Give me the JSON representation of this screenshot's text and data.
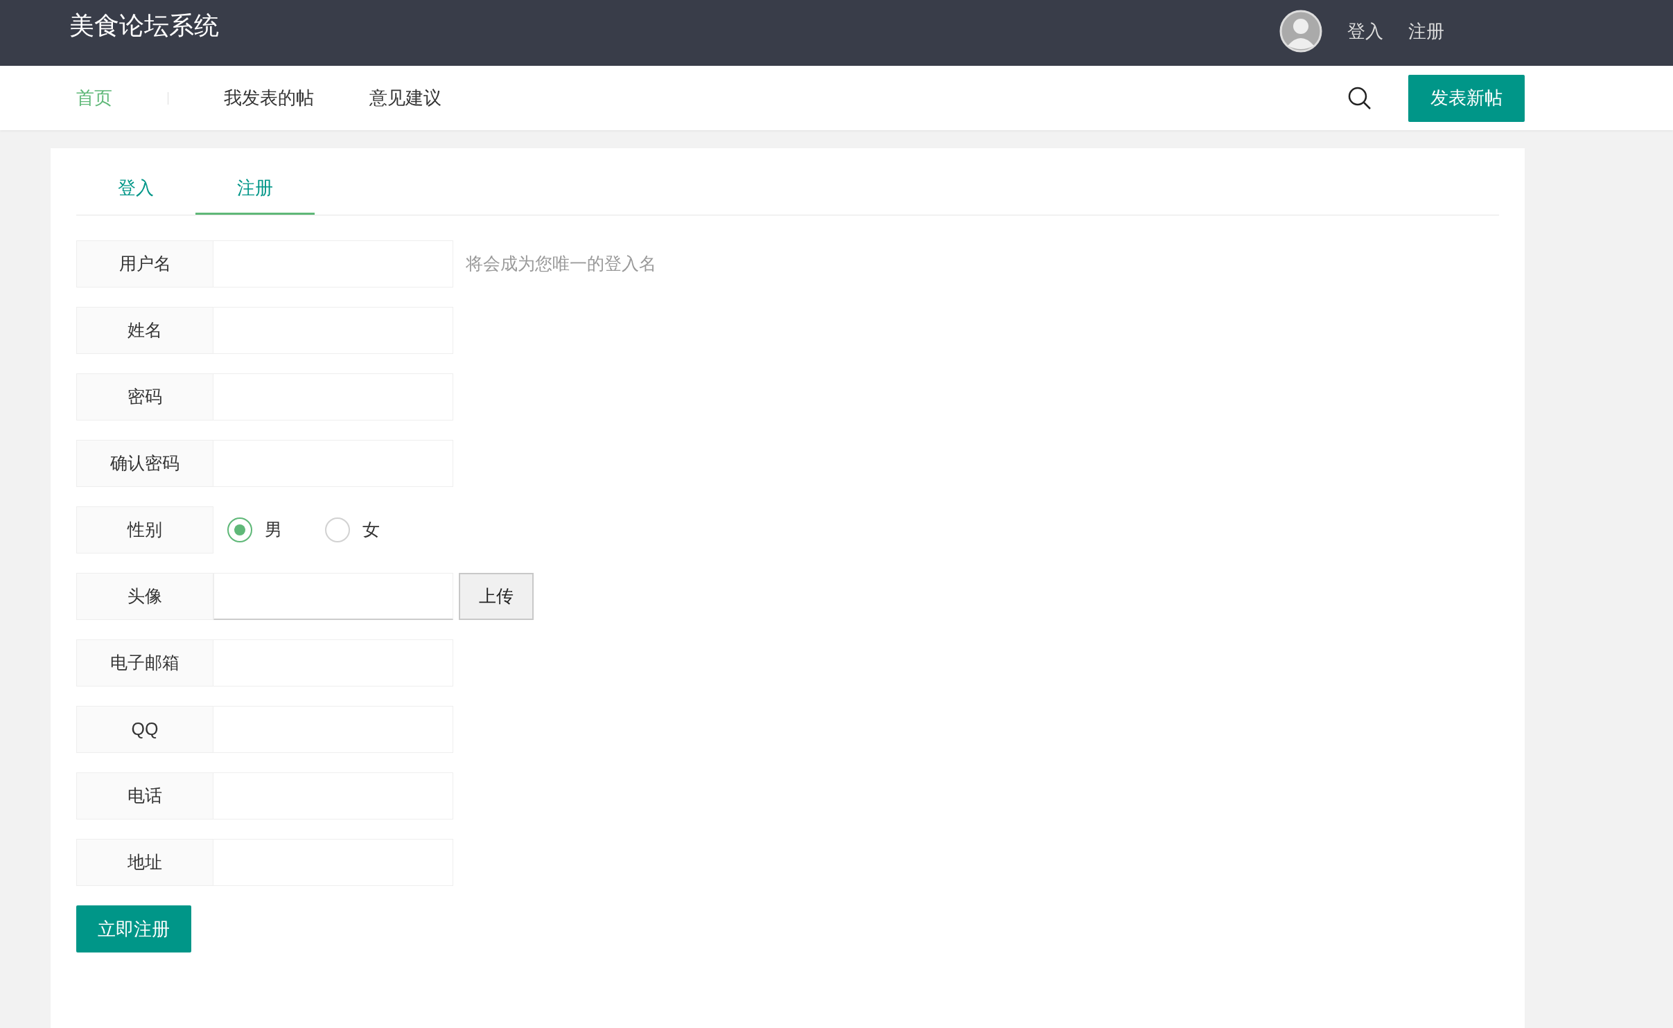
{
  "header": {
    "title": "美食论坛系统",
    "links": [
      "登入",
      "注册"
    ]
  },
  "nav": {
    "items": [
      {
        "label": "首页",
        "selected": true
      },
      {
        "label": "我发表的帖",
        "selected": false
      },
      {
        "label": "意见建议",
        "selected": false
      }
    ],
    "button": "发表新帖"
  },
  "tabs": [
    {
      "label": "登入",
      "selected": false
    },
    {
      "label": "注册",
      "selected": true
    }
  ],
  "form": [
    {
      "kind": "input",
      "label": "用户名",
      "hint": "将会成为您唯一的登入名"
    },
    {
      "kind": "input",
      "label": "姓名"
    },
    {
      "kind": "input",
      "label": "密码"
    },
    {
      "kind": "input",
      "label": "确认密码"
    },
    {
      "kind": "radio",
      "label": "性别",
      "options": [
        {
          "label": "男",
          "selected": true
        },
        {
          "label": "女",
          "selected": false
        }
      ]
    },
    {
      "kind": "file",
      "label": "头像",
      "button": "上传"
    },
    {
      "kind": "input",
      "label": "电子邮箱"
    },
    {
      "kind": "input",
      "label": "QQ"
    },
    {
      "kind": "input",
      "label": "电话"
    },
    {
      "kind": "input",
      "label": "地址"
    }
  ],
  "submit": "立即注册"
}
